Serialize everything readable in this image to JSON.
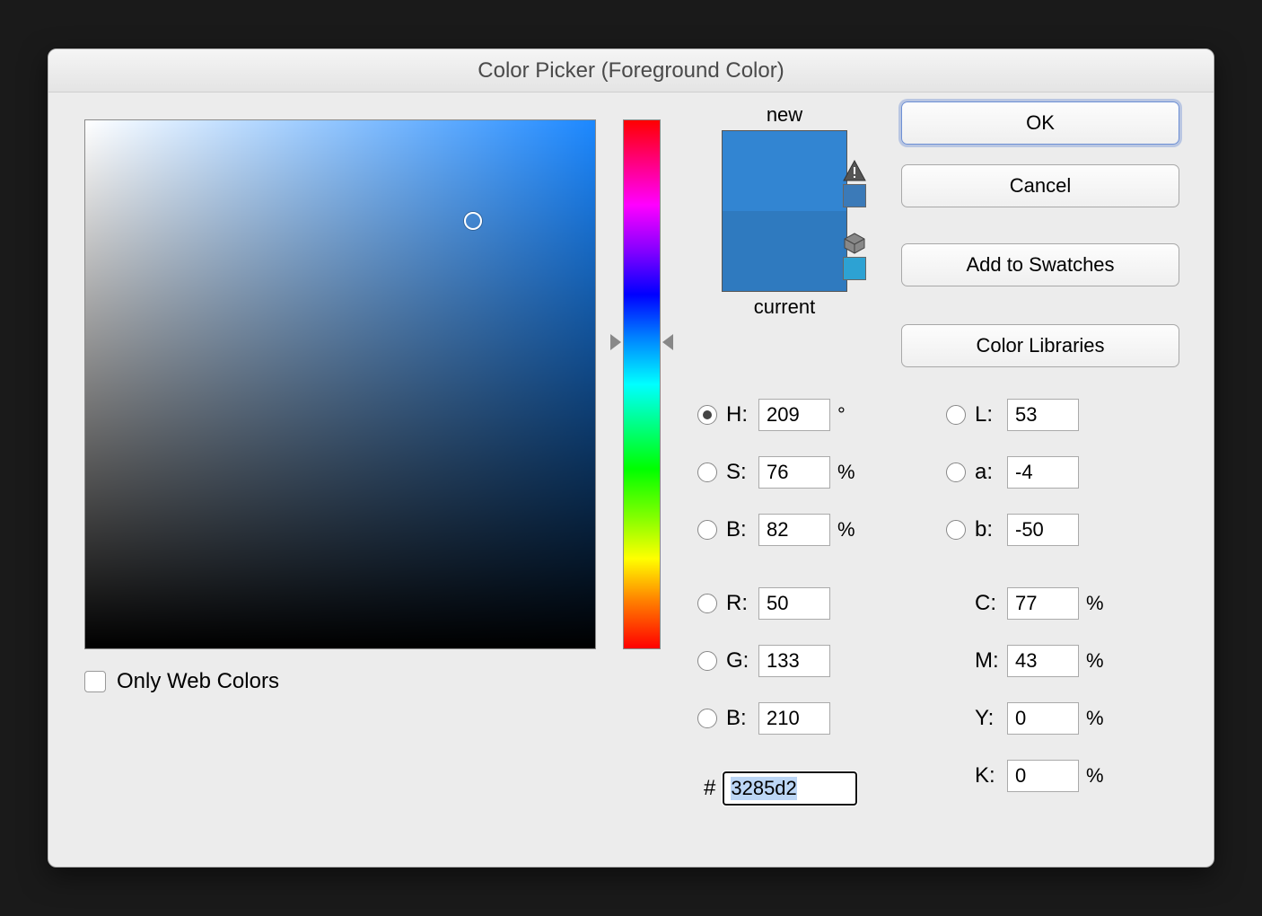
{
  "dialog": {
    "title": "Color Picker (Foreground Color)"
  },
  "buttons": {
    "ok": "OK",
    "cancel": "Cancel",
    "add_swatches": "Add to Swatches",
    "color_libraries": "Color Libraries"
  },
  "swatch": {
    "new_label": "new",
    "current_label": "current",
    "new_color": "#3285d2",
    "current_color": "#2f7abf",
    "warn_color": "#3b7ab8",
    "cube_color": "#2da2d3"
  },
  "picker": {
    "hue_base": "#1c88ff",
    "cursor_x_pct": 76,
    "cursor_y_pct": 19,
    "hue_slider_pct": 42
  },
  "only_web_label": "Only Web Colors",
  "fields": {
    "H": {
      "label": "H:",
      "value": "209",
      "unit": "°",
      "radio": true,
      "selected": true
    },
    "S": {
      "label": "S:",
      "value": "76",
      "unit": "%",
      "radio": true
    },
    "B": {
      "label": "B:",
      "value": "82",
      "unit": "%",
      "radio": true
    },
    "R": {
      "label": "R:",
      "value": "50",
      "unit": "",
      "radio": true
    },
    "G": {
      "label": "G:",
      "value": "133",
      "unit": "",
      "radio": true
    },
    "B2": {
      "label": "B:",
      "value": "210",
      "unit": "",
      "radio": true
    },
    "L": {
      "label": "L:",
      "value": "53",
      "unit": "",
      "radio": true
    },
    "a": {
      "label": "a:",
      "value": "-4",
      "unit": "",
      "radio": true
    },
    "b": {
      "label": "b:",
      "value": "-50",
      "unit": "",
      "radio": true
    },
    "C": {
      "label": "C:",
      "value": "77",
      "unit": "%"
    },
    "M": {
      "label": "M:",
      "value": "43",
      "unit": "%"
    },
    "Y": {
      "label": "Y:",
      "value": "0",
      "unit": "%"
    },
    "K": {
      "label": "K:",
      "value": "0",
      "unit": "%"
    }
  },
  "hex": {
    "label": "#",
    "value": "3285d2"
  }
}
